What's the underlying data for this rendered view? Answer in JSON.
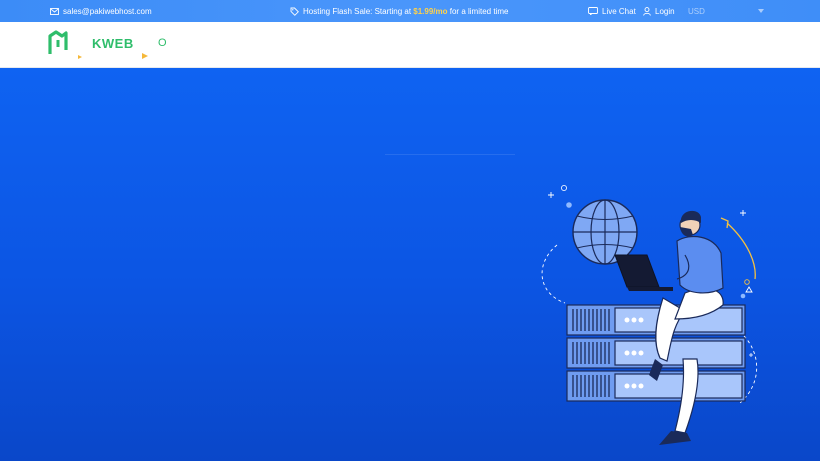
{
  "topbar": {
    "email": "sales@pakiwebhost.com",
    "promo_prefix": "Hosting Flash Sale: Starting at ",
    "promo_price": "$1.99/mo",
    "promo_suffix": " for a limited time",
    "live_chat": "Live Chat",
    "login": "Login",
    "currency": "USD"
  },
  "brand": {
    "logo_text": "KWEB",
    "logo_tail": "O",
    "green": "#2fbd6b"
  },
  "colors": {
    "topbar": "#4a96fb",
    "hero": "#0c55e3",
    "price_accent": "#ffd24a"
  },
  "icons": [
    "envelope-icon",
    "tag-icon",
    "chat-icon",
    "user-icon",
    "chevron-down-icon"
  ]
}
